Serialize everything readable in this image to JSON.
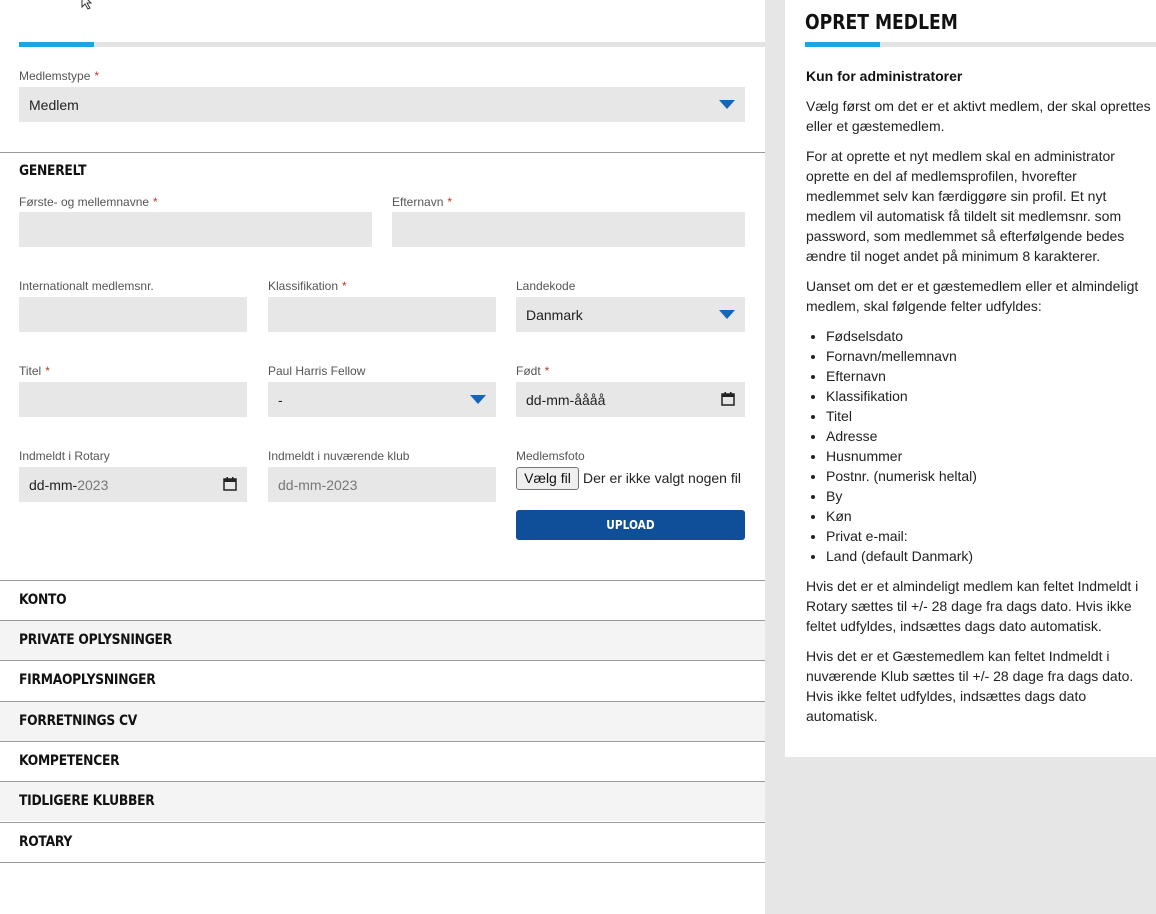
{
  "form": {
    "progress_fraction": 0.1,
    "member_type": {
      "label": "Medlemstype",
      "required_mark": "*",
      "value": "Medlem"
    },
    "general": {
      "title": "GENERELT",
      "first_names": {
        "label": "Første- og mellemnavne",
        "required_mark": "*",
        "value": ""
      },
      "last_name": {
        "label": "Efternavn",
        "required_mark": "*",
        "value": ""
      },
      "intl_member_no": {
        "label": "Internationalt medlemsnr.",
        "value": ""
      },
      "classification": {
        "label": "Klassifikation",
        "required_mark": "*",
        "value": ""
      },
      "country_code": {
        "label": "Landekode",
        "value": "Danmark"
      },
      "title_field": {
        "label": "Titel",
        "required_mark": "*",
        "value": ""
      },
      "phf": {
        "label": "Paul Harris Fellow",
        "value": "-"
      },
      "born": {
        "label": "Født",
        "required_mark": "*",
        "placeholder": "dd-mm-åååå"
      },
      "joined_rotary": {
        "label": "Indmeldt i Rotary",
        "value_dd": "dd-mm-",
        "value_year": "2023"
      },
      "joined_club": {
        "label": "Indmeldt i nuværende klub",
        "value": "dd-mm-2023"
      },
      "photo": {
        "label": "Medlemsfoto",
        "choose_button": "Vælg fil",
        "no_file_text": "Der er ikke valgt nogen fil"
      },
      "upload_button": "UPLOAD"
    },
    "sections": [
      "KONTO",
      "PRIVATE OPLYSNINGER",
      "FIRMAOPLYSNINGER",
      "FORRETNINGS CV",
      "KOMPETENCER",
      "TIDLIGERE KLUBBER",
      "ROTARY"
    ]
  },
  "help": {
    "title": "OPRET MEDLEM",
    "subtitle": "Kun for administratorer",
    "p1": "Vælg først om det er et aktivt medlem, der skal oprettes eller et gæstemedlem.",
    "p2": "For at oprette et nyt medlem skal en administrator oprette en del af medlemsprofilen, hvorefter medlemmet selv kan færdiggøre sin profil. Et nyt medlem vil automatisk få tildelt sit medlemsnr. som password, som medlemmet så efterfølgende bedes ændre til noget andet på minimum 8 karakterer.",
    "p3": "Uanset om det er et gæstemedlem eller et almindeligt medlem, skal følgende felter udfyldes:",
    "list": [
      "Fødselsdato",
      "Fornavn/mellemnavn",
      "Efternavn",
      "Klassifikation",
      "Titel",
      "Adresse",
      "Husnummer",
      "Postnr. (numerisk heltal)",
      "By",
      "Køn",
      "Privat e-mail:",
      "Land (default Danmark)"
    ],
    "p4": "Hvis det er et almindeligt medlem kan feltet Indmeldt i Rotary sættes til +/- 28 dage fra dags dato. Hvis ikke feltet udfyldes, indsættes dags dato automatisk.",
    "p5": "Hvis det er et Gæstemedlem kan feltet Indmeldt i nuværende Klub sættes til +/- 28 dage fra dags dato. Hvis ikke feltet udfyldes, indsættes dags dato automatisk."
  },
  "colors": {
    "accent": "#1ba7dd",
    "brand_button": "#0f4e98",
    "caret": "#1565b8",
    "required": "#c0392b"
  }
}
